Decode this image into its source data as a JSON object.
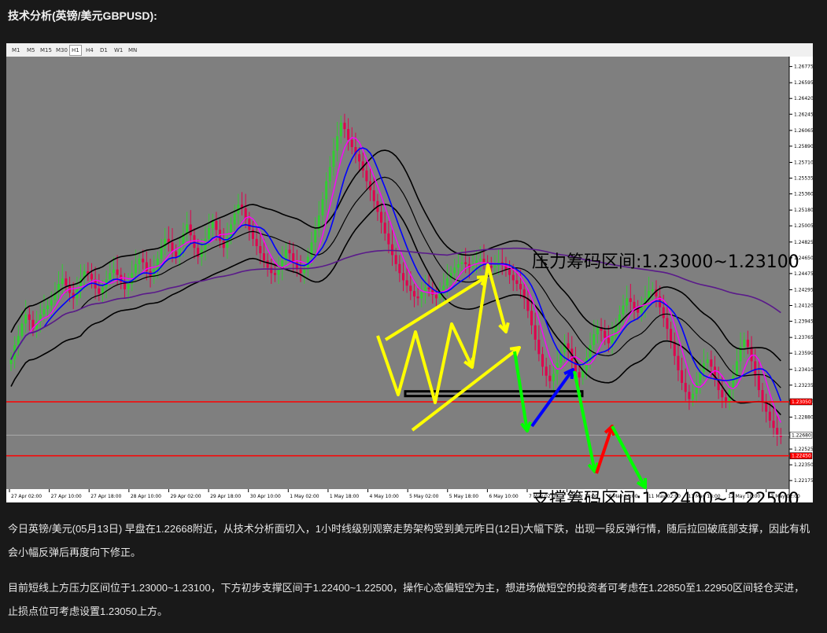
{
  "heading": "技术分析(英镑/美元GBPUSD):",
  "timeframes": [
    "M1",
    "M5",
    "M15",
    "M30",
    "H1",
    "H4",
    "D1",
    "W1",
    "MN"
  ],
  "active_timeframe": "H1",
  "colors": {
    "chart_bg": "#7f7f7f",
    "bull_candle": "#32cd32",
    "bear_candle": "#e0004d",
    "bollinger": "#000000",
    "ma_fast": "#0000ff",
    "ma_slow": "#ff00ff",
    "ma_long": "#5a1a8a",
    "level_line": "#ff0000",
    "arrow_yellow": "#ffff00",
    "arrow_green": "#00ff00",
    "arrow_blue": "#0000ff",
    "arrow_red": "#ff0000"
  },
  "chart_data": {
    "type": "candlestick",
    "symbol": "GBPUSD",
    "timeframe": "H1",
    "y_ticks": [
      "1.26775",
      "1.26595",
      "1.26420",
      "1.26245",
      "1.26065",
      "1.25890",
      "1.25710",
      "1.25535",
      "1.25360",
      "1.25180",
      "1.25005",
      "1.24825",
      "1.24650",
      "1.24475",
      "1.24295",
      "1.24120",
      "1.23945",
      "1.23765",
      "1.23590",
      "1.23410",
      "1.23235",
      "1.23060",
      "1.22880",
      "1.22525",
      "1.22350",
      "1.22175"
    ],
    "ylim": [
      1.2208,
      1.2685
    ],
    "x_ticks": [
      "27 Apr 02:00",
      "27 Apr 10:00",
      "27 Apr 18:00",
      "28 Apr 10:00",
      "29 Apr 02:00",
      "29 Apr 18:00",
      "30 Apr 10:00",
      "1 May 02:00",
      "1 May 18:00",
      "4 May 10:00",
      "5 May 02:00",
      "5 May 18:00",
      "6 May 10:00",
      "7 May 02:00",
      "7 May 18:00",
      "8 May 10:00",
      "11 May 02:00",
      "11 May 18:00",
      "12 May 10:00",
      "13 May 02:00"
    ],
    "price_tags": [
      "1.23050",
      "1.22680",
      "1.22450"
    ],
    "close": [
      1.2352,
      1.2368,
      1.2378,
      1.2392,
      1.2402,
      1.2396,
      1.2386,
      1.2394,
      1.2402,
      1.2408,
      1.2412,
      1.2418,
      1.2426,
      1.2436,
      1.2442,
      1.2434,
      1.2426,
      1.242,
      1.243,
      1.2442,
      1.245,
      1.2447,
      1.2441,
      1.2431,
      1.2425,
      1.2432,
      1.2441,
      1.2448,
      1.2452,
      1.2446,
      1.2438,
      1.243,
      1.2436,
      1.2448,
      1.2458,
      1.2464,
      1.246,
      1.245,
      1.2444,
      1.2452,
      1.2464,
      1.2476,
      1.2486,
      1.2482,
      1.2472,
      1.2466,
      1.2478,
      1.2492,
      1.2502,
      1.249,
      1.2476,
      1.2466,
      1.2474,
      1.2486,
      1.2498,
      1.2506,
      1.2496,
      1.2484,
      1.2476,
      1.2488,
      1.2502,
      1.2514,
      1.2524,
      1.252,
      1.2508,
      1.2496,
      1.2486,
      1.2478,
      1.247,
      1.2462,
      1.2454,
      1.2448,
      1.2446,
      1.2452,
      1.2462,
      1.2474,
      1.247,
      1.246,
      1.2452,
      1.2448,
      1.2452,
      1.2466,
      1.2482,
      1.2496,
      1.2512,
      1.253,
      1.255,
      1.2566,
      1.2584,
      1.26,
      1.2615,
      1.2608,
      1.2596,
      1.2588,
      1.258,
      1.2572,
      1.2562,
      1.255,
      1.254,
      1.2528,
      1.2516,
      1.2504,
      1.2492,
      1.248,
      1.2468,
      1.2458,
      1.2448,
      1.244,
      1.2434,
      1.2428,
      1.2422,
      1.242,
      1.2426,
      1.2432,
      1.243,
      1.2424,
      1.242,
      1.2426,
      1.2434,
      1.2442,
      1.2448,
      1.2454,
      1.2458,
      1.246,
      1.2458,
      1.2454,
      1.2458,
      1.2462,
      1.2464,
      1.246,
      1.2456,
      1.2454,
      1.2456,
      1.246,
      1.2458,
      1.2452,
      1.2446,
      1.244,
      1.2436,
      1.243,
      1.242,
      1.2406,
      1.239,
      1.2374,
      1.2358,
      1.2344,
      1.2334,
      1.2328,
      1.2336,
      1.2348,
      1.236,
      1.237,
      1.2364,
      1.235,
      1.2338,
      1.2332,
      1.234,
      1.2354,
      1.2368,
      1.238,
      1.2388,
      1.2384,
      1.2376,
      1.237,
      1.2378,
      1.239,
      1.2402,
      1.2412,
      1.242,
      1.2416,
      1.2408,
      1.2404,
      1.241,
      1.242,
      1.2428,
      1.243,
      1.2422,
      1.241,
      1.2398,
      1.2386,
      1.2372,
      1.2356,
      1.234,
      1.2326,
      1.2316,
      1.2308,
      1.2314,
      1.2326,
      1.2338,
      1.2348,
      1.2352,
      1.2344,
      1.233,
      1.2318,
      1.231,
      1.2306,
      1.2318,
      1.2334,
      1.235,
      1.2366,
      1.2374,
      1.2366,
      1.235,
      1.2334,
      1.2318,
      1.2304,
      1.2294,
      1.2284,
      1.2276,
      1.2268,
      1.2266
    ],
    "annotations": [
      "压力筹码区间:1.23000~1.23100",
      "支撑筹码区间:1.22400~1.22500"
    ]
  },
  "paragraphs": [
    "今日英镑/美元(05月13日) 早盘在1.22668附近，从技术分析面切入，1小时线级别观察走势架构受到美元昨日(12日)大幅下跌，出现一段反弹行情，随后拉回破底部支撑，因此有机会小幅反弹后再度向下修正。",
    "目前短线上方压力区间位于1.23000~1.23100，下方初步支撑区间于1.22400~1.22500，操作心态偏短空为主，想进场做短空的投资者可考虑在1.22850至1.22950区间轻仓买进，止损点位可考虑设置1.23050上方。"
  ]
}
